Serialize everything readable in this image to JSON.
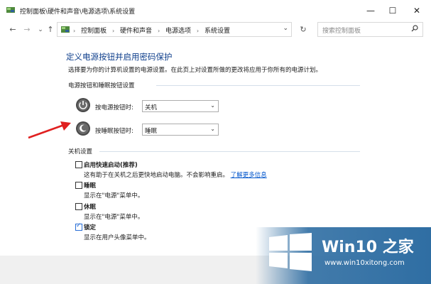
{
  "window": {
    "title": "控制面板\\硬件和声音\\电源选项\\系统设置",
    "minimize": "—",
    "maximize": "☐",
    "close": "✕"
  },
  "nav": {
    "back": "←",
    "forward": "→",
    "recent": "⌄",
    "up": "↑",
    "breadcrumbs": [
      "控制面板",
      "硬件和声音",
      "电源选项",
      "系统设置"
    ],
    "separator": "›",
    "dropdown": "⌄",
    "refresh": "↻"
  },
  "search": {
    "placeholder": "搜索控制面板",
    "icon": "search-icon"
  },
  "page": {
    "title": "定义电源按钮并启用密码保护",
    "description": "选择要为你的计算机设置的电源设置。在此页上对设置所做的更改将应用于你所有的电源计划。"
  },
  "power_section": {
    "heading": "电源按钮和睡眠按钮设置",
    "power_button": {
      "label": "按电源按钮时:",
      "value": "关机"
    },
    "sleep_button": {
      "label": "按睡眠按钮时:",
      "value": "睡眠"
    }
  },
  "shutdown_section": {
    "heading": "关机设置",
    "options": [
      {
        "label": "启用快速启动(推荐)",
        "desc": "这有助于在关机之后更快地启动电脑。不会影响重启。",
        "link": "了解更多信息",
        "checked": false
      },
      {
        "label": "睡眠",
        "desc": "显示在\"电源\"菜单中。",
        "checked": false
      },
      {
        "label": "休眠",
        "desc": "显示在\"电源\"菜单中。",
        "checked": false
      },
      {
        "label": "锁定",
        "desc": "显示在用户头像菜单中。",
        "checked": true
      }
    ]
  },
  "watermark": {
    "brand": "Win10 之家",
    "url": "www.win10xitong.com"
  },
  "colors": {
    "title_blue": "#0f3f8c",
    "link_blue": "#0055cc",
    "arrow_red": "#e02020",
    "accent": "#2a6fd6"
  }
}
